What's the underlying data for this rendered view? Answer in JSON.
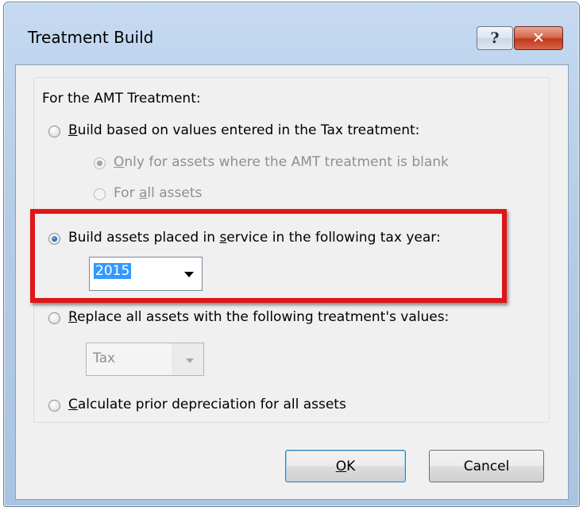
{
  "window": {
    "title": "Treatment Build",
    "help_button": "?",
    "close_button": "✕"
  },
  "group_label": "For the AMT Treatment:",
  "options": {
    "build_tax": {
      "key": "B",
      "rest": "uild based on values entered in the Tax treatment:",
      "selected": false,
      "sub_options": [
        {
          "key": "O",
          "rest": "nly for assets where the AMT treatment is blank",
          "selected": true,
          "enabled": false
        },
        {
          "pre": "For ",
          "key": "a",
          "rest": "ll assets",
          "selected": false,
          "enabled": false
        }
      ]
    },
    "build_year": {
      "pre": "Build assets placed in ",
      "key": "s",
      "rest": "ervice in the following tax year:",
      "selected": true,
      "year_value": "2015"
    },
    "replace": {
      "key": "R",
      "rest": "eplace all assets with the following treatment's values:",
      "selected": false,
      "treatment_value": "Tax"
    },
    "prior_dep": {
      "key": "C",
      "rest": "alculate prior depreciation for all assets",
      "selected": false
    }
  },
  "buttons": {
    "ok": {
      "key": "O",
      "rest": "K"
    },
    "cancel": "Cancel"
  },
  "colors": {
    "highlight": "#e01515",
    "selection": "#3399ff"
  }
}
